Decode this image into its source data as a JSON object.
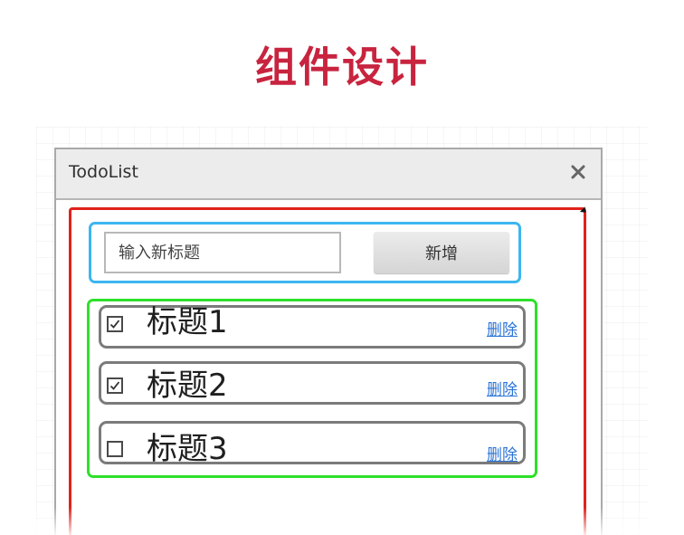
{
  "slide": {
    "title": "组件设计"
  },
  "window": {
    "title": "TodoList"
  },
  "header": {
    "input_placeholder": "输入新标题",
    "input_value": "",
    "add_label": "新增"
  },
  "todos": [
    {
      "label": "标题1",
      "checked": true,
      "delete_label": "删除"
    },
    {
      "label": "标题2",
      "checked": true,
      "delete_label": "删除"
    },
    {
      "label": "标题3",
      "checked": false,
      "delete_label": "删除"
    }
  ],
  "colors": {
    "title": "#c8243f",
    "app_frame": "#e0221b",
    "header_frame": "#3cb6f0",
    "list_frame": "#2ee02a",
    "item_border": "#7b7b7b",
    "link": "#2b74d6"
  },
  "icons": {
    "close": "close-icon",
    "checkbox_checked": "checkbox-checked-icon",
    "checkbox_unchecked": "checkbox-unchecked-icon"
  }
}
